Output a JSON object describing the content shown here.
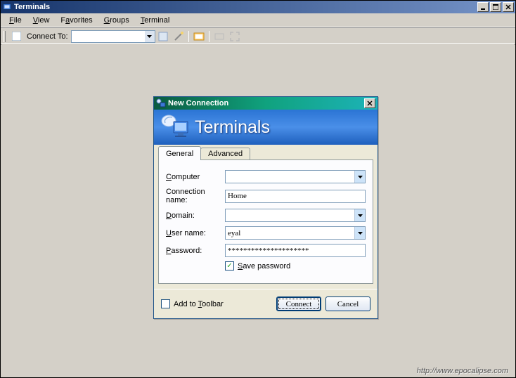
{
  "main": {
    "title": "Terminals",
    "menubar": [
      "File",
      "View",
      "Favorites",
      "Groups",
      "Terminal"
    ],
    "toolbar": {
      "connect_label": "Connect To:"
    }
  },
  "dialog": {
    "title": "New Connection",
    "banner_title": "Terminals",
    "tabs": {
      "general": "General",
      "advanced": "Advanced"
    },
    "form": {
      "computer_label": "Computer",
      "computer_value": "",
      "connection_label": "Connection name:",
      "connection_value": "Home",
      "domain_label": "Domain:",
      "domain_value": "",
      "username_label": "User name:",
      "username_value": "eyal",
      "password_label": "Password:",
      "password_value": "*********************",
      "save_password_label": "Save password",
      "save_password_checked": true
    },
    "bottom": {
      "add_toolbar_label": "Add to Toolbar",
      "add_toolbar_checked": false,
      "connect": "Connect",
      "cancel": "Cancel"
    }
  },
  "watermark": "http://www.epocalipse.com"
}
